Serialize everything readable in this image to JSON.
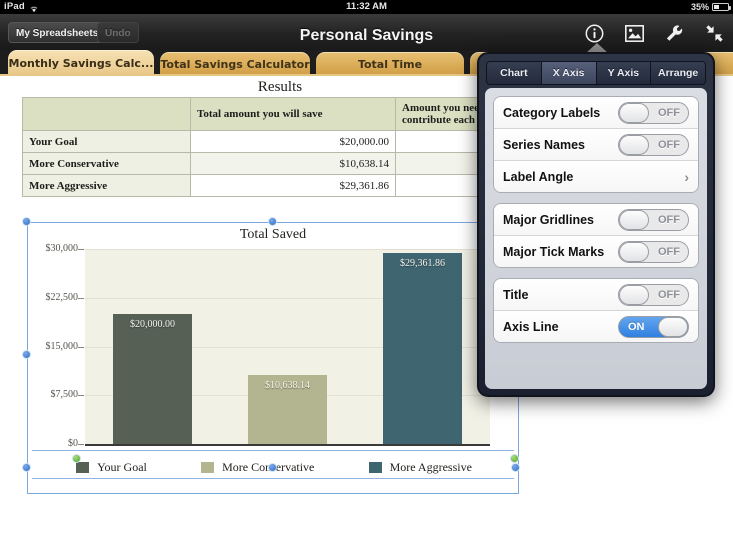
{
  "statusbar": {
    "device": "iPad",
    "wifi_icon": "wifi-icon",
    "time": "11:32 AM",
    "battery_percent": "35%",
    "battery_icon": "battery-icon"
  },
  "toolbar": {
    "spreadsheets_label": "My Spreadsheets",
    "undo_label": "Undo",
    "document_title": "Personal Savings",
    "icons": [
      {
        "name": "info-icon",
        "glyph": "i"
      },
      {
        "name": "image-icon",
        "glyph": "picture"
      },
      {
        "name": "wrench-icon",
        "glyph": "wrench"
      },
      {
        "name": "collapse-arrows-icon",
        "glyph": "arrows"
      }
    ]
  },
  "sheet_tabs": [
    {
      "label": "Monthly Savings Calc...",
      "active": true
    },
    {
      "label": "Total Savings Calculator",
      "active": false
    },
    {
      "label": "Total Time",
      "active": false
    }
  ],
  "table": {
    "title": "Results",
    "columns": [
      "",
      "Total amount you will save",
      "Amount you need to contribute each month"
    ],
    "column_header_2_line1": "Amount you need",
    "column_header_2_line2": "contribute each m",
    "rows": [
      {
        "label": "Your Goal",
        "amount": "$20,000.00",
        "monthly": ""
      },
      {
        "label": "More Conservative",
        "amount": "$10,638.14",
        "monthly": ""
      },
      {
        "label": "More Aggressive",
        "amount": "$29,361.86",
        "monthly": ""
      }
    ]
  },
  "chart_data": {
    "type": "bar",
    "title": "Total Saved",
    "xlabel": "",
    "ylabel": "",
    "categories": [
      "Your Goal",
      "More Conservative",
      "More Aggressive"
    ],
    "values": [
      20000.0,
      10638.14,
      29361.86
    ],
    "value_labels": [
      "$20,000.00",
      "$10,638.14",
      "$29,361.86"
    ],
    "ylim": [
      0,
      30000
    ],
    "yticks": [
      "$0",
      "$7,500",
      "$15,000",
      "$22,500",
      "$30,000"
    ],
    "ytick_values": [
      0,
      7500,
      15000,
      22500,
      30000
    ],
    "grid": true,
    "legend_position": "bottom",
    "series_colors": [
      "#566055",
      "#b3b490",
      "#3f6570"
    ],
    "plot_background": "#f2f1e6"
  },
  "popover": {
    "segments": [
      {
        "label": "Chart",
        "selected": false
      },
      {
        "label": "X Axis",
        "selected": true
      },
      {
        "label": "Y Axis",
        "selected": false
      },
      {
        "label": "Arrange",
        "selected": false
      }
    ],
    "groups": [
      {
        "rows": [
          {
            "label": "Category Labels",
            "control": "switch",
            "state": "OFF"
          },
          {
            "label": "Series Names",
            "control": "switch",
            "state": "OFF"
          },
          {
            "label": "Label Angle",
            "control": "disclosure",
            "state": ""
          }
        ]
      },
      {
        "rows": [
          {
            "label": "Major Gridlines",
            "control": "switch",
            "state": "OFF"
          },
          {
            "label": "Major Tick Marks",
            "control": "switch",
            "state": "OFF"
          }
        ]
      },
      {
        "rows": [
          {
            "label": "Title",
            "control": "switch",
            "state": "OFF"
          },
          {
            "label": "Axis Line",
            "control": "switch",
            "state": "ON"
          }
        ]
      }
    ]
  },
  "colors": {
    "accent_blue": "#2f7fe0",
    "tab_active": "#eed29a",
    "tab_inactive": "#d9ab55",
    "selection_blue": "#7ba7dd",
    "handle_green": "#4fa028"
  }
}
